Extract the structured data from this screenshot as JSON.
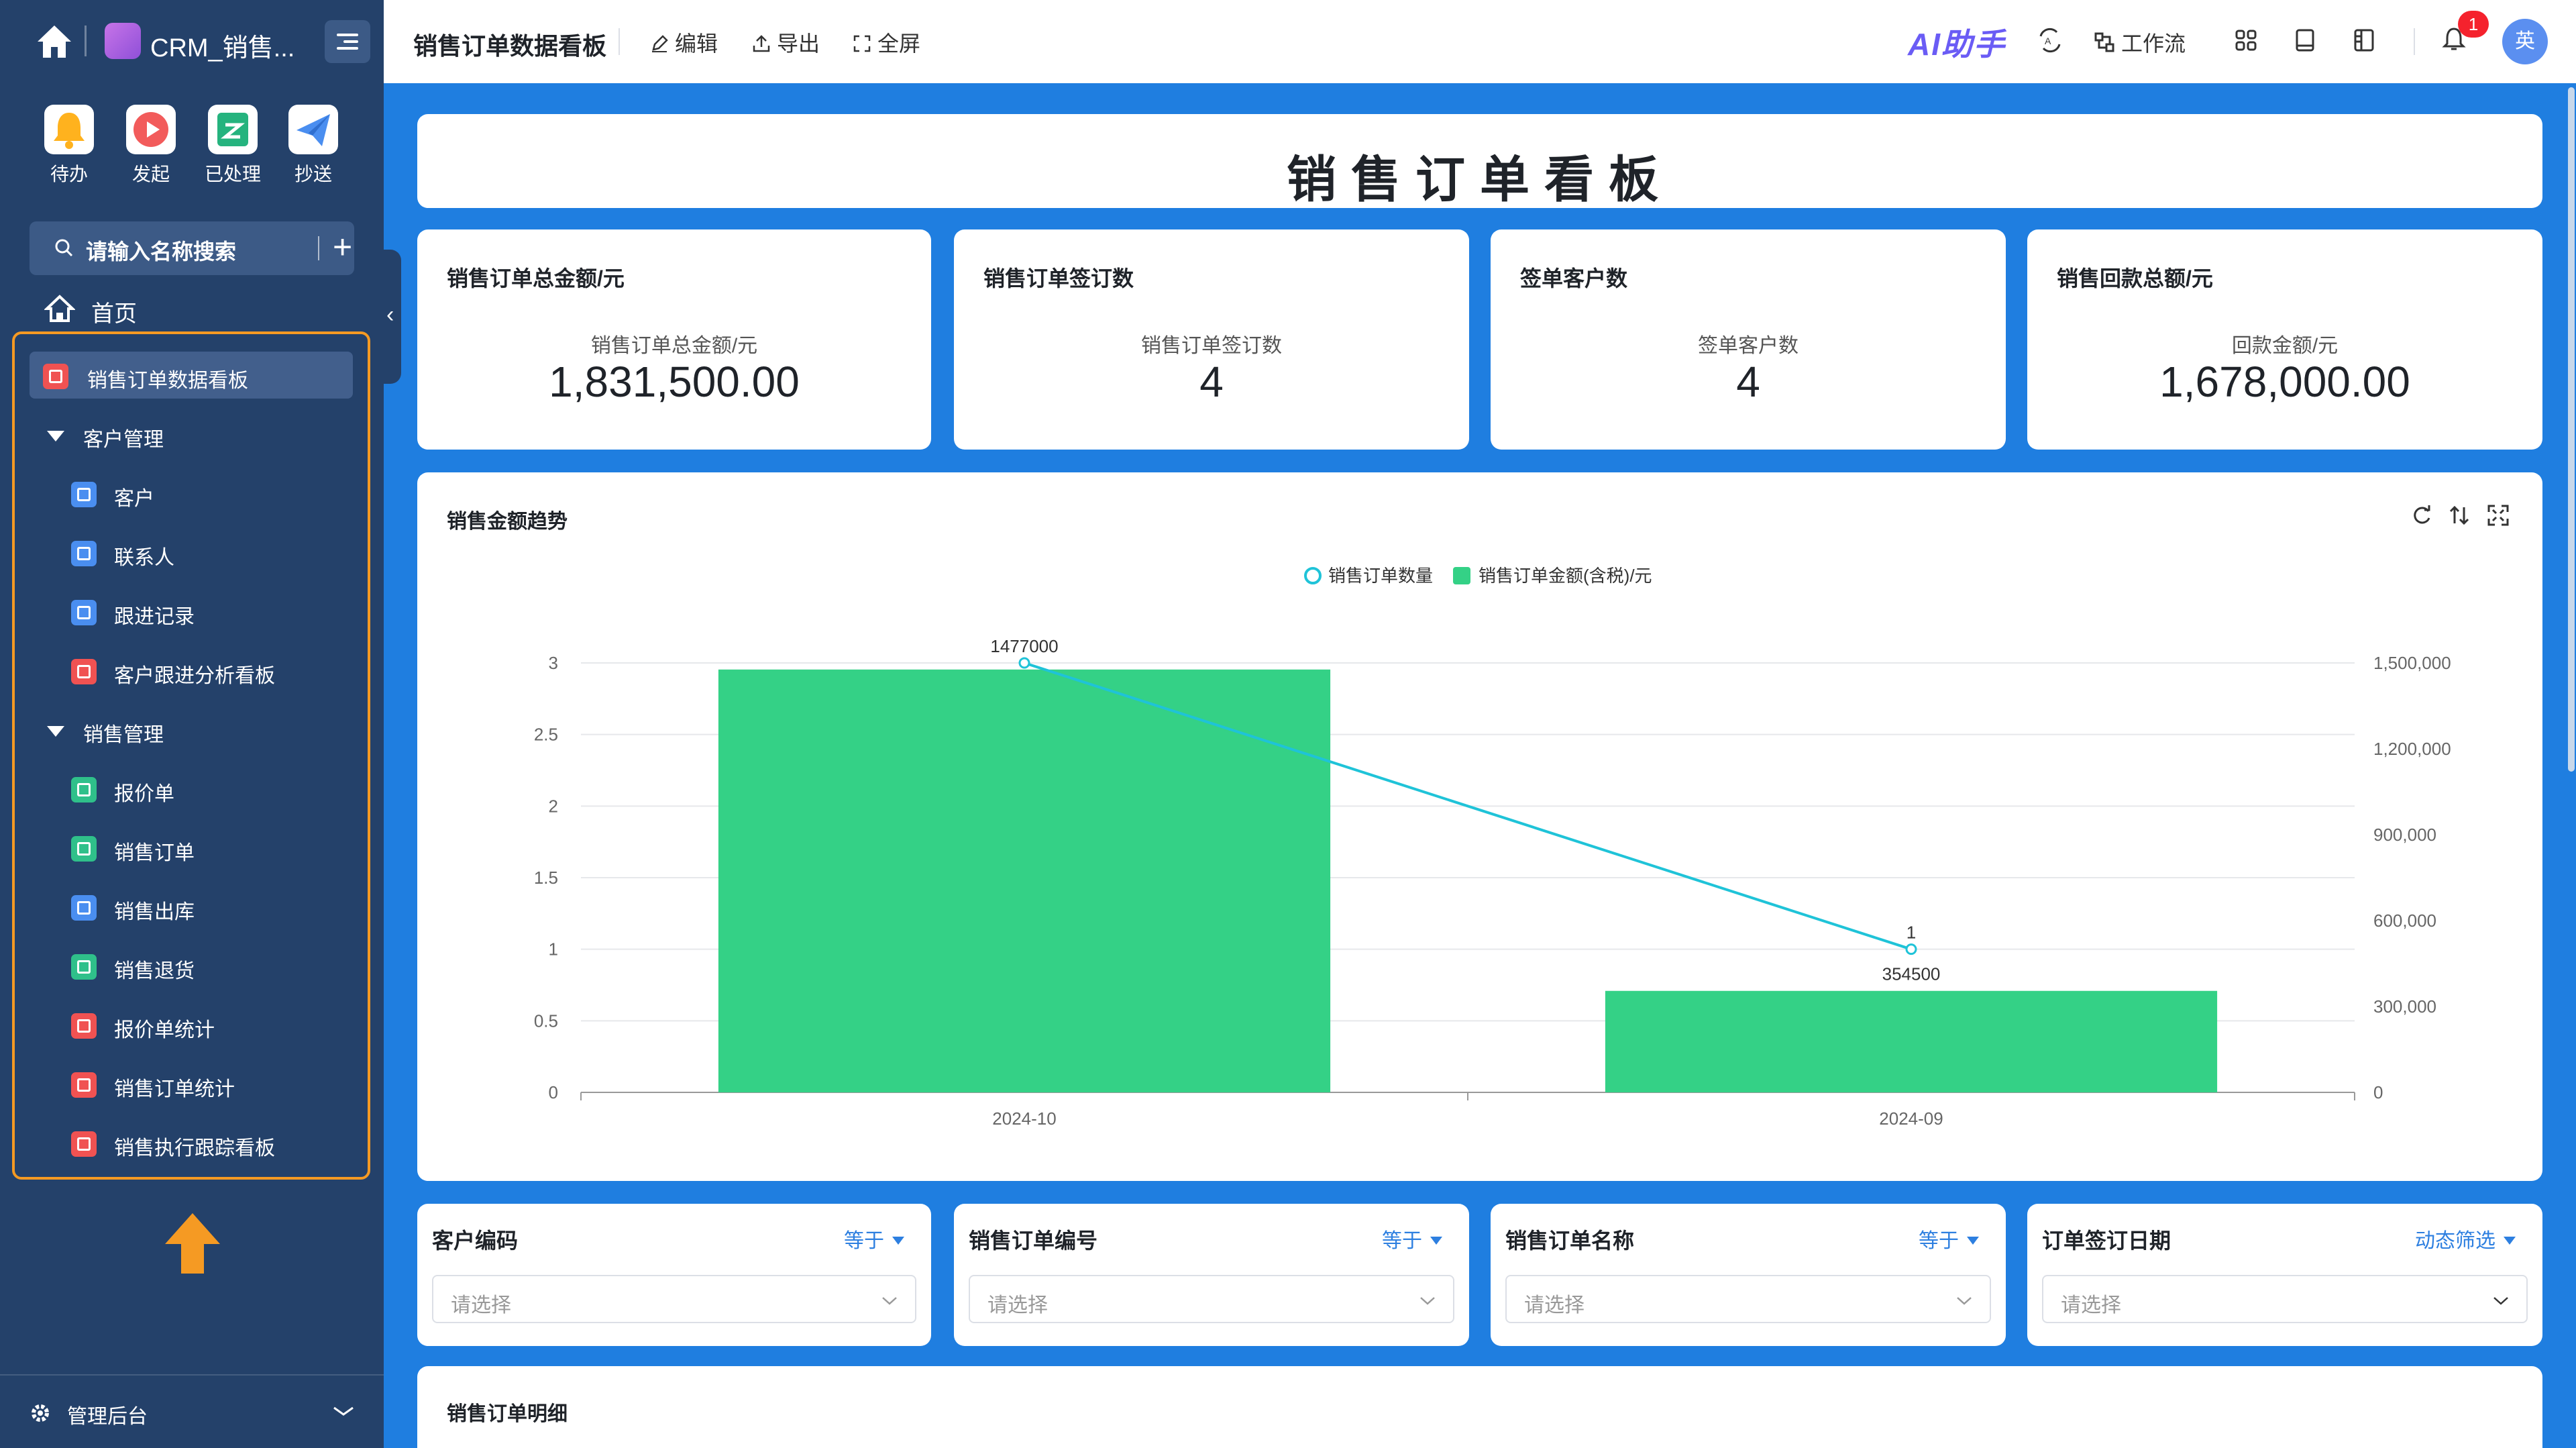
{
  "sidebar": {
    "app_title": "CRM_销售...",
    "quick_actions": [
      {
        "label": "待办",
        "icon": "bell-icon",
        "color": "#ffb21e"
      },
      {
        "label": "发起",
        "icon": "play-icon",
        "color": "#f25b5b"
      },
      {
        "label": "已处理",
        "icon": "check-doc-icon",
        "color": "#25b37e"
      },
      {
        "label": "抄送",
        "icon": "send-icon",
        "color": "#4a8ef0"
      }
    ],
    "search_placeholder": "请输入名称搜索",
    "home_label": "首页",
    "items": [
      {
        "label": "销售订单数据看板",
        "type": "dashboard",
        "active": true
      },
      {
        "label": "客户管理",
        "type": "group"
      },
      {
        "label": "客户",
        "type": "form"
      },
      {
        "label": "联系人",
        "type": "form"
      },
      {
        "label": "跟进记录",
        "type": "form"
      },
      {
        "label": "客户跟进分析看板",
        "type": "dashboard"
      },
      {
        "label": "销售管理",
        "type": "group"
      },
      {
        "label": "报价单",
        "type": "flow"
      },
      {
        "label": "销售订单",
        "type": "flow"
      },
      {
        "label": "销售出库",
        "type": "form"
      },
      {
        "label": "销售退货",
        "type": "flow"
      },
      {
        "label": "报价单统计",
        "type": "dashboard"
      },
      {
        "label": "销售订单统计",
        "type": "dashboard"
      },
      {
        "label": "销售执行跟踪看板",
        "type": "dashboard"
      }
    ],
    "admin_label": "管理后台"
  },
  "header": {
    "title": "销售订单数据看板",
    "edit_label": "编辑",
    "export_label": "导出",
    "fullscreen_label": "全屏",
    "ai_label": "AI助手",
    "workflow_label": "工作流",
    "notification_count": "1",
    "avatar_text": "英"
  },
  "board": {
    "title": "销售订单看板"
  },
  "kpis": [
    {
      "title": "销售订单总金额/元",
      "subtitle": "销售订单总金额/元",
      "value": "1,831,500.00"
    },
    {
      "title": "销售订单签订数",
      "subtitle": "销售订单签订数",
      "value": "4"
    },
    {
      "title": "签单客户数",
      "subtitle": "签单客户数",
      "value": "4"
    },
    {
      "title": "销售回款总额/元",
      "subtitle": "回款金额/元",
      "value": "1,678,000.00"
    }
  ],
  "chart_section": {
    "title": "销售金额趋势"
  },
  "chart_data": {
    "type": "bar",
    "categories": [
      "2024-10",
      "2024-09"
    ],
    "series": [
      {
        "name": "销售订单数量",
        "type": "line",
        "axis": "left",
        "values": [
          3,
          1
        ],
        "labels": [
          "1477000",
          "1"
        ],
        "color": "#1fc3d8"
      },
      {
        "name": "销售订单金额(含税)/元",
        "type": "bar",
        "axis": "right",
        "values": [
          1477000,
          354500
        ],
        "labels": [
          "",
          "354500"
        ],
        "color": "#34d186"
      }
    ],
    "y_left_ticks": [
      "0",
      "0.5",
      "1",
      "1.5",
      "2",
      "2.5",
      "3"
    ],
    "y_left_range": [
      0,
      3
    ],
    "y_right_ticks": [
      "0",
      "300,000",
      "600,000",
      "900,000",
      "1,200,000",
      "1,500,000"
    ],
    "y_right_range": [
      0,
      1500000
    ],
    "legend_position": "top-center",
    "grid": true
  },
  "filters": [
    {
      "label": "客户编码",
      "operator": "等于",
      "placeholder": "请选择"
    },
    {
      "label": "销售订单编号",
      "operator": "等于",
      "placeholder": "请选择"
    },
    {
      "label": "销售订单名称",
      "operator": "等于",
      "placeholder": "请选择"
    },
    {
      "label": "订单签订日期",
      "operator": "动态筛选",
      "placeholder": "请选择"
    }
  ],
  "detail": {
    "title": "销售订单明细"
  }
}
